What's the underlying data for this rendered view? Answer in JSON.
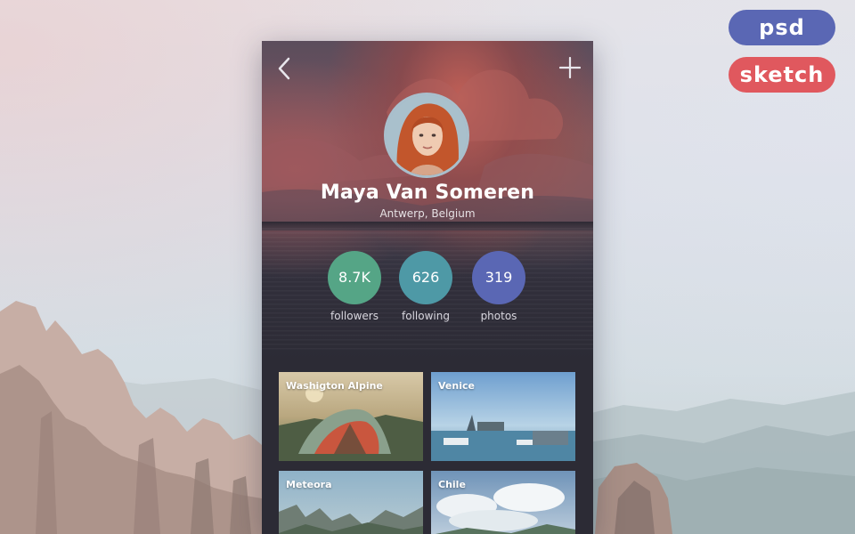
{
  "badges": {
    "psd": "psd",
    "sketch": "sketch"
  },
  "colors": {
    "psd_badge": "#5a67b4",
    "sketch_badge": "#e0585e",
    "followers": "#55a586",
    "following": "#4e99a6",
    "photos": "#5a67b4"
  },
  "header": {
    "back_icon": "chevron-left-icon",
    "add_icon": "plus-icon"
  },
  "profile": {
    "name": "Maya Van Someren",
    "location": "Antwerp, Belgium"
  },
  "stats": {
    "followers": {
      "value": "8.7K",
      "label": "followers"
    },
    "following": {
      "value": "626",
      "label": "following"
    },
    "photos": {
      "value": "319",
      "label": "photos"
    }
  },
  "gallery": [
    {
      "title": "Washigton Alpine"
    },
    {
      "title": "Venice"
    },
    {
      "title": "Meteora"
    },
    {
      "title": "Chile"
    }
  ]
}
